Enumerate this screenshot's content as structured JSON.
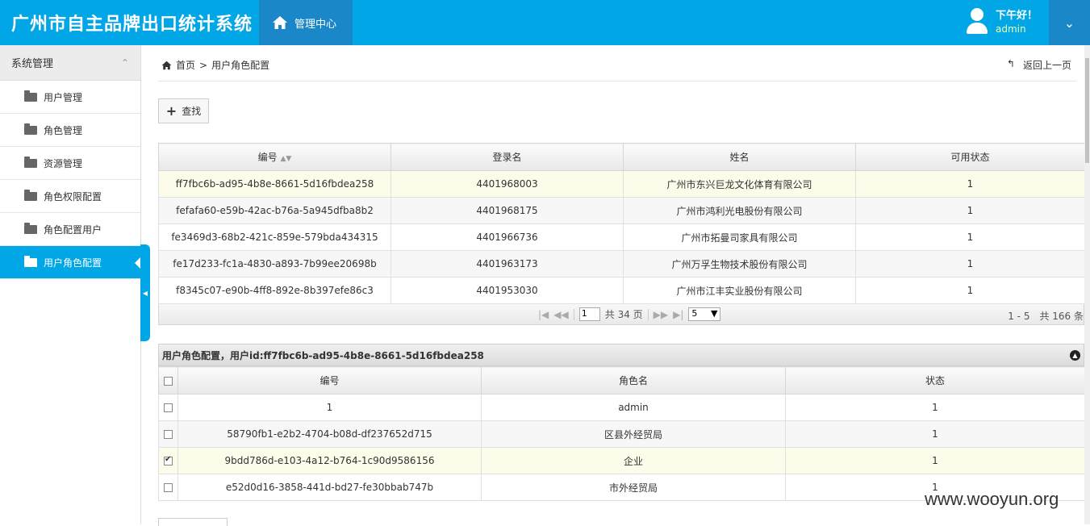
{
  "header": {
    "brand": "广州市自主品牌出口统计系统",
    "mgmt_label": "管理中心",
    "greeting": "下午好！",
    "username": "admin"
  },
  "sidebar": {
    "group_title": "系统管理",
    "items": [
      {
        "label": "用户管理"
      },
      {
        "label": "角色管理"
      },
      {
        "label": "资源管理"
      },
      {
        "label": "角色权限配置"
      },
      {
        "label": "角色配置用户"
      },
      {
        "label": "用户角色配置"
      }
    ]
  },
  "breadcrumb": {
    "home": "首页",
    "sep": ">",
    "current": "用户角色配置"
  },
  "back_label": "返回上一页",
  "search_button": "查找",
  "grid1": {
    "headers": [
      "编号",
      "登录名",
      "姓名",
      "可用状态"
    ],
    "rows": [
      [
        "ff7fbc6b-ad95-4b8e-8661-5d16fbdea258",
        "4401968003",
        "广州市东兴巨龙文化体育有限公司",
        "1"
      ],
      [
        "fefafa60-e59b-42ac-b76a-5a945dfba8b2",
        "4401968175",
        "广州市鸿利光电股份有限公司",
        "1"
      ],
      [
        "fe3469d3-68b2-421c-859e-579bda434315",
        "4401966736",
        "广州市拓曼司家具有限公司",
        "1"
      ],
      [
        "fe17d233-fc1a-4830-a893-7b99ee20698b",
        "4401963173",
        "广州万孚生物技术股份有限公司",
        "1"
      ],
      [
        "f8345c07-e90b-4ff8-892e-8b397efe86c3",
        "4401953030",
        "广州市江丰实业股份有限公司",
        "1"
      ]
    ],
    "pager": {
      "page": "1",
      "total_pages": "共 34 页",
      "page_size": "5",
      "info": "1 - 5　共 166 条"
    }
  },
  "grid2": {
    "title": "用户角色配置，用户id:ff7fbc6b-ad95-4b8e-8661-5d16fbdea258",
    "headers": [
      "编号",
      "角色名",
      "状态"
    ],
    "rows": [
      {
        "checked": false,
        "cells": [
          "1",
          "admin",
          "1"
        ]
      },
      {
        "checked": false,
        "cells": [
          "58790fb1-e2b2-4704-b08d-df237652d715",
          "区县外经贸局",
          "1"
        ]
      },
      {
        "checked": true,
        "cells": [
          "9bdd786d-e103-4a12-b764-1c90d9586156",
          "企业",
          "1"
        ]
      },
      {
        "checked": false,
        "cells": [
          "e52d0d16-3858-441d-bd27-fe30bbab747b",
          "市外经贸局",
          "1"
        ]
      }
    ]
  },
  "watermark": "www.wooyun.org",
  "colors": {
    "accent": "#00a6e6",
    "accent_dark": "#1a87c9",
    "selected_row": "#fdfbe9"
  }
}
